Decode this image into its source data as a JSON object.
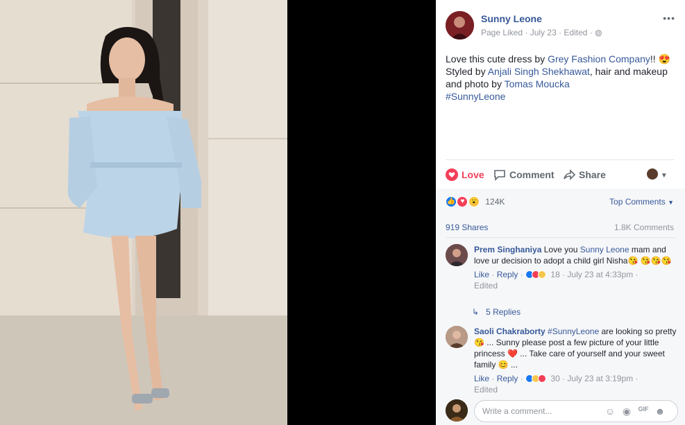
{
  "colors": {
    "link": "#365899",
    "love": "#f33e58",
    "like": "#1877f2",
    "muted": "#90949c"
  },
  "post": {
    "author": "Sunny Leone",
    "page_status": "Page Liked",
    "date": "July 23",
    "edited": "Edited",
    "more_icon": "more-horizontal-icon",
    "text_1": "Love this cute dress by ",
    "link_1": "Grey Fashion Company",
    "text_2": "!! 😍",
    "text_3": "Styled by ",
    "link_2": "Anjali Singh Shekhawat",
    "text_4": ", hair and makeup and photo by ",
    "link_3": "Tomas Moucka",
    "hashtag": "#SunnyLeone"
  },
  "actions": {
    "love": "Love",
    "comment": "Comment",
    "share": "Share"
  },
  "stats": {
    "reaction_count": "124K",
    "top_comments": "Top Comments",
    "shares": "919 Shares",
    "comments": "1.8K Comments"
  },
  "comments": [
    {
      "author": "Prem Singhaniya",
      "text_before": "Love you ",
      "mention": "Sunny Leone",
      "text_after": " mam and love ur decision to adopt a child girl Nisha😘 😘😘😘",
      "like": "Like",
      "reply": "Reply",
      "reactions": "18",
      "date": "July 23 at 4:33pm",
      "edited": "Edited",
      "replies": "5 Replies"
    },
    {
      "author": "Saoli Chakraborty",
      "mention": "#SunnyLeone",
      "text_after": " are looking so pretty 😘 ... Sunny please post a few picture of your little princess ❤️ ... Take care of yourself and your sweet family 😊 ...",
      "like": "Like",
      "reply": "Reply",
      "reactions": "30",
      "date": "July 23 at 3:19pm",
      "edited": "Edited"
    }
  ],
  "composer": {
    "placeholder": "Write a comment..."
  }
}
